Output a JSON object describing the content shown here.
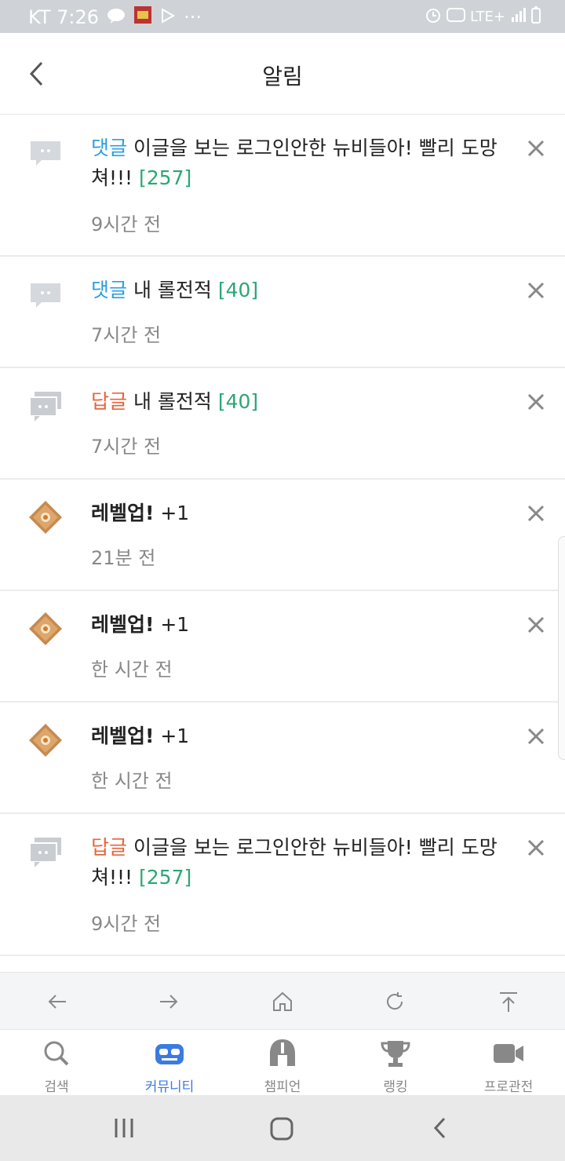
{
  "status_bar": {
    "carrier_time": "KT 7:26",
    "dots": "···",
    "network": "LTE+"
  },
  "header": {
    "title": "알림"
  },
  "notifications": [
    {
      "kind": "comment",
      "tag": "댓글",
      "text": " 이글을 보는 로그인안한 뉴비들아! 빨리 도망쳐!!! ",
      "count": "[257]",
      "time": "9시간 전",
      "icon": "comment-icon"
    },
    {
      "kind": "comment",
      "tag": "댓글",
      "text": " 내 롤전적 ",
      "count": "[40]",
      "time": "7시간 전",
      "icon": "comment-icon"
    },
    {
      "kind": "reply",
      "tag": "답글",
      "text": " 내 롤전적 ",
      "count": "[40]",
      "time": "7시간 전",
      "icon": "reply-icon"
    },
    {
      "kind": "levelup",
      "tag": "레벨업!",
      "text": " +1",
      "count": "",
      "time": "21분 전",
      "icon": "level-up-icon"
    },
    {
      "kind": "levelup",
      "tag": "레벨업!",
      "text": " +1",
      "count": "",
      "time": "한 시간 전",
      "icon": "level-up-icon"
    },
    {
      "kind": "levelup",
      "tag": "레벨업!",
      "text": " +1",
      "count": "",
      "time": "한 시간 전",
      "icon": "level-up-icon"
    },
    {
      "kind": "reply",
      "tag": "답글",
      "text": " 이글을 보는 로그인안한 뉴비들아! 빨리 도망쳐!!! ",
      "count": "[257]",
      "time": "9시간 전",
      "icon": "reply-icon"
    }
  ],
  "tabs": [
    {
      "label": "검색",
      "icon": "search-icon"
    },
    {
      "label": "커뮤니티",
      "icon": "community-icon",
      "active": true
    },
    {
      "label": "챔피언",
      "icon": "champion-helmet-icon"
    },
    {
      "label": "랭킹",
      "icon": "trophy-icon"
    },
    {
      "label": "프로관전",
      "icon": "video-camera-icon"
    }
  ],
  "colors": {
    "comment": "#2b9ee0",
    "reply": "#e8633c",
    "count": "#2aa775",
    "active_tab": "#3a7be0"
  }
}
